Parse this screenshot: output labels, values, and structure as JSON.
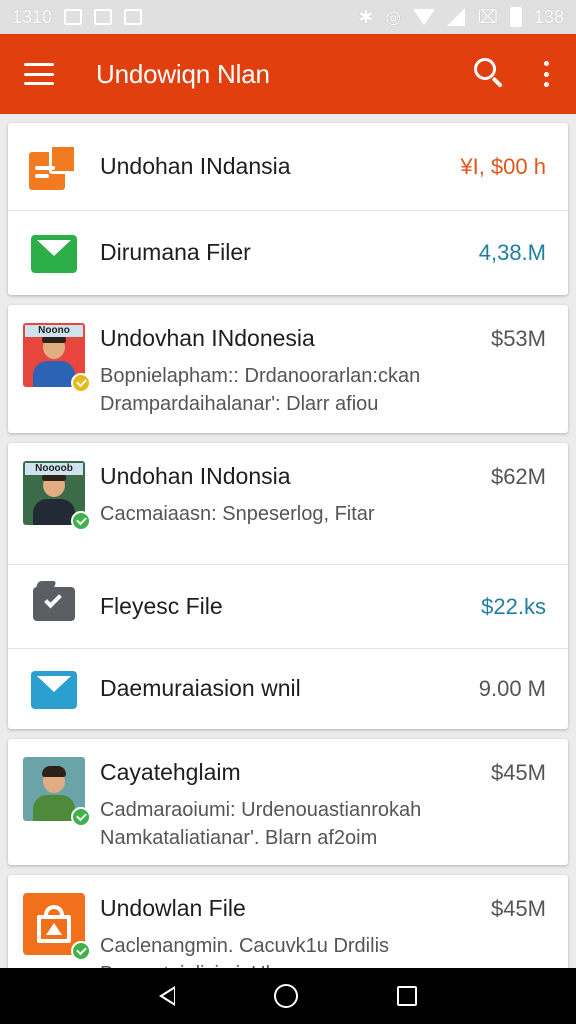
{
  "status_bar": {
    "time": "1310",
    "clock": "138"
  },
  "app_bar": {
    "title": "Undowiqn Nlan",
    "menu_icon": "hamburger-icon",
    "search_icon": "search-icon",
    "more_icon": "more-vert-icon"
  },
  "cards": [
    {
      "rows": [
        {
          "title": "Undohan INdansia",
          "value": "¥I, $00 h",
          "value_color": "#e1561b",
          "icon": "document-icon",
          "subtitle": []
        },
        {
          "title": "Dirumana Filer",
          "value": "4,38.M",
          "value_color": "#1e7fa0",
          "icon": "mail-icon",
          "subtitle": []
        }
      ]
    },
    {
      "rows": [
        {
          "title": "Undovhan INdonesia",
          "value": "$53M",
          "value_color": "#555555",
          "icon": "avatar",
          "subtitle": [
            "Bopnielapham:: Drdanoorarlan:ckan",
            "Drampardaihalanar': Dlarr afiou"
          ]
        }
      ]
    },
    {
      "rows": [
        {
          "title": "Undohan INdonsia",
          "value": "$62M",
          "value_color": "#555555",
          "icon": "avatar",
          "subtitle": [
            "Cacmaiaasn: Snpeserlog, Fitar"
          ]
        },
        {
          "title": "Fleyesc File",
          "value": "$22.ks",
          "value_color": "#1e7fa0",
          "icon": "folder-check-icon",
          "subtitle": []
        },
        {
          "title": "Daemuraiasion wnil",
          "value": "9.00 M",
          "value_color": "#555555",
          "icon": "mail-icon",
          "subtitle": []
        }
      ]
    },
    {
      "rows": [
        {
          "title": "Cayatehglaim",
          "value": "$45M",
          "value_color": "#555555",
          "icon": "avatar",
          "subtitle": [
            "Cadmaraoiumi: Urdenouastianrokah",
            "Namkataliatianar'. Blarn af2oim"
          ]
        }
      ]
    },
    {
      "rows": [
        {
          "title": "Undowlan File",
          "value": "$45M",
          "value_color": "#555555",
          "icon": "shopping-bag-icon",
          "subtitle": [
            "Caclenangmin. Cacuvk1u Drdilis",
            "Bamnatuialisimi: Ular"
          ]
        }
      ]
    }
  ],
  "avatars": [
    {
      "label": "Noono",
      "shirt": "#2d63b5",
      "bg": "#e8453c"
    },
    {
      "label": "Noooob",
      "shirt": "#222a35",
      "bg": "#3c6b4a"
    },
    {
      "label": "",
      "shirt": "#4f8a3a",
      "bg": "#6ba4a8"
    }
  ],
  "colors": {
    "accent": "#e1400e",
    "mail_green": "#2cae49",
    "mail_blue": "#2b9fd0",
    "badge_green": "#3fb24b",
    "badge_yellow": "#e6b91c"
  },
  "nav_bar": {
    "back_icon": "back-icon",
    "home_icon": "home-icon",
    "recents_icon": "recents-icon"
  }
}
